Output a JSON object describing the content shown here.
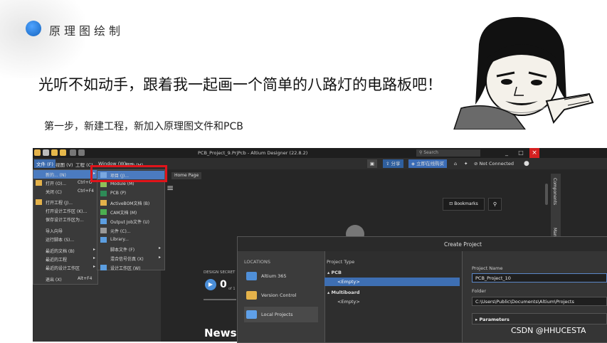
{
  "slide": {
    "section_title": "原理图绘制",
    "headline": "光听不如动手，跟着我一起画一个简单的八路灯的电路板吧！",
    "step": "第一步，新建工程，新加入原理图文件和PCB",
    "watermark": "CSDN @HHUCESTA",
    "accent_color": "#1e7bd6"
  },
  "app": {
    "window_title": "PCB_Project_9.PrjPcb - Altium Designer (22.8.2)",
    "search_placeholder": "Search",
    "titlebar_buttons": [
      "_",
      "□"
    ],
    "close_label": "×",
    "menu": {
      "file": "文件 (F)",
      "view": "视图 (V)",
      "project": "工程 (C)",
      "window": "Window (W)",
      "help": "帮助 (H)"
    },
    "toolbar_right": {
      "share": "分享",
      "collab": "立即在线购买",
      "not_connected": "Not Connected"
    },
    "home_tab": "Home Page",
    "bookmarks": "Bookmarks",
    "search_icon": "search-icon",
    "right_panels": [
      "Components",
      "Manufacturer P..."
    ],
    "design_label": "DESIGN SECRET",
    "counter": "0",
    "counter_of": "of 1",
    "news": "News"
  },
  "file_menu": [
    {
      "label": "新的... (N)",
      "shortcut": "",
      "arrow": "▸",
      "highlight": true
    },
    {
      "label": "打开 (O)...",
      "shortcut": "Ctrl+O",
      "arrow": ""
    },
    {
      "label": "关闭 (C)",
      "shortcut": "Ctrl+F4",
      "arrow": ""
    },
    {
      "label": "打开工程 (J)...",
      "shortcut": "",
      "arrow": ""
    },
    {
      "label": "打开设计工作区 (K)...",
      "shortcut": "",
      "arrow": ""
    },
    {
      "label": "保存设计工作区为...",
      "shortcut": "",
      "arrow": ""
    },
    {
      "label": "导入向导",
      "shortcut": "",
      "arrow": ""
    },
    {
      "label": "运行脚本 (S)...",
      "shortcut": "",
      "arrow": ""
    },
    {
      "label": "最近的文档 (B)",
      "shortcut": "",
      "arrow": "▸"
    },
    {
      "label": "最近的工程",
      "shortcut": "",
      "arrow": "▸"
    },
    {
      "label": "最近的设计工作区",
      "shortcut": "",
      "arrow": "▸"
    },
    {
      "label": "退出 (X)",
      "shortcut": "Alt+F4",
      "arrow": ""
    }
  ],
  "new_submenu": [
    {
      "label": "项目 (J)...",
      "arrow": "",
      "highlight": true
    },
    {
      "label": "Module (M)",
      "arrow": ""
    },
    {
      "label": "PCB (P)",
      "arrow": ""
    },
    {
      "label": "ActiveBOM文档 (B)",
      "arrow": ""
    },
    {
      "label": "CAM文档 (M)",
      "arrow": ""
    },
    {
      "label": "Output Job文件 (U)",
      "arrow": ""
    },
    {
      "label": "元件 (C)...",
      "arrow": ""
    },
    {
      "label": "Library...",
      "arrow": ""
    },
    {
      "label": "脚本文件 (F)",
      "arrow": "▸"
    },
    {
      "label": "混合信号仿真 (X)",
      "arrow": "▸"
    },
    {
      "label": "设计工作区 (W)",
      "arrow": ""
    }
  ],
  "dialog": {
    "title": "Create Project",
    "locations_header": "LOCATIONS",
    "locations": [
      {
        "label": "Altium 365",
        "icon": "cloud-icon",
        "selected": false
      },
      {
        "label": "Version Control",
        "icon": "folder-icon",
        "selected": false
      },
      {
        "label": "Local Projects",
        "icon": "monitor-icon",
        "selected": true
      }
    ],
    "type_header": "Project Type",
    "types": [
      {
        "label": "▴ PCB",
        "indent": false,
        "selected": false,
        "bold": true
      },
      {
        "label": "<Empty>",
        "indent": true,
        "selected": true,
        "bold": false
      },
      {
        "label": "▴ Multiboard",
        "indent": false,
        "selected": false,
        "bold": true
      },
      {
        "label": "<Empty>",
        "indent": true,
        "selected": false,
        "bold": false
      }
    ],
    "project_name_label": "Project Name",
    "project_name_value": "PCB_Project_10",
    "folder_label": "Folder",
    "folder_value": "C:\\Users\\Public\\Documents\\Altium\\Projects",
    "parameters_label": "▸ Parameters"
  }
}
